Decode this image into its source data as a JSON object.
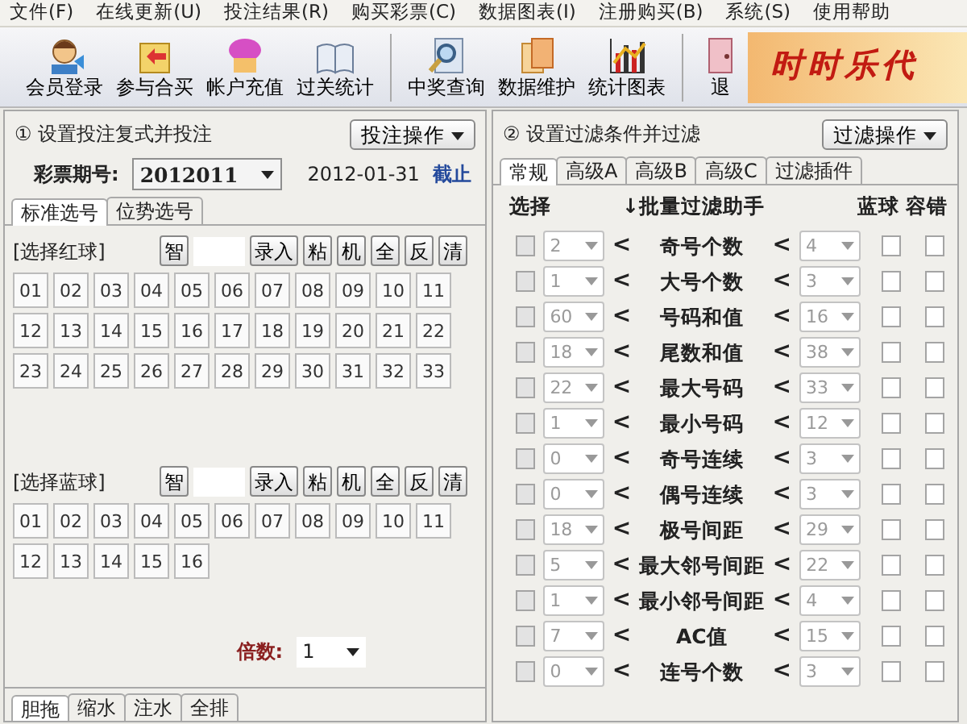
{
  "menu": [
    "文件(F)",
    "在线更新(U)",
    "投注结果(R)",
    "购买彩票(C)",
    "数据图表(I)",
    "注册购买(B)",
    "系统(S)",
    "使用帮助"
  ],
  "toolbar": {
    "groups": [
      [
        "会员登录",
        "参与合买",
        "帐户充值",
        "过关统计"
      ],
      [
        "中奖查询",
        "数据维护",
        "统计图表"
      ],
      [
        "退"
      ]
    ],
    "banner": "时时乐代"
  },
  "bet_panel": {
    "title": "① 设置投注复式并投注",
    "action": "投注操作",
    "issue_label": "彩票期号:",
    "issue": "2012011",
    "date": "2012-01-31",
    "deadline": "截止",
    "tabs": [
      {
        "label": "标准选号",
        "selected": true
      },
      {
        "label": "位势选号",
        "selected": false
      }
    ],
    "red": {
      "label": "[选择红球]",
      "tools": [
        "智",
        "录入",
        "粘",
        "机",
        "全",
        "反",
        "清"
      ],
      "balls": [
        "01",
        "02",
        "03",
        "04",
        "05",
        "06",
        "07",
        "08",
        "09",
        "10",
        "11",
        "12",
        "13",
        "14",
        "15",
        "16",
        "17",
        "18",
        "19",
        "20",
        "21",
        "22",
        "23",
        "24",
        "25",
        "26",
        "27",
        "28",
        "29",
        "30",
        "31",
        "32",
        "33"
      ]
    },
    "blue": {
      "label": "[选择蓝球]",
      "tools": [
        "智",
        "录入",
        "粘",
        "机",
        "全",
        "反",
        "清"
      ],
      "balls": [
        "01",
        "02",
        "03",
        "04",
        "05",
        "06",
        "07",
        "08",
        "09",
        "10",
        "11",
        "12",
        "13",
        "14",
        "15",
        "16"
      ]
    },
    "multiple_label": "倍数:",
    "multiple": "1",
    "bottom_tabs": [
      {
        "label": "胆拖",
        "selected": true
      },
      {
        "label": "缩水",
        "selected": false
      },
      {
        "label": "注水",
        "selected": false
      },
      {
        "label": "全排",
        "selected": false
      }
    ]
  },
  "filter_panel": {
    "title": "② 设置过滤条件并过滤",
    "action": "过滤操作",
    "tabs": [
      {
        "label": "常规",
        "selected": true
      },
      {
        "label": "高级A",
        "selected": false
      },
      {
        "label": "高级B",
        "selected": false
      },
      {
        "label": "高级C",
        "selected": false
      },
      {
        "label": "过滤插件",
        "selected": false
      }
    ],
    "columns": [
      "选择",
      "↓批量过滤助手",
      "蓝球",
      "容错"
    ],
    "lt": "<",
    "rows": [
      {
        "checked": false,
        "min": "2",
        "name": "奇号个数",
        "max": "4",
        "blue": false,
        "tolerance": false,
        "disabled": true
      },
      {
        "checked": false,
        "min": "1",
        "name": "大号个数",
        "max": "3",
        "blue": false,
        "tolerance": false,
        "disabled": true
      },
      {
        "checked": false,
        "min": "60",
        "name": "号码和值",
        "max": "16",
        "blue": false,
        "tolerance": false,
        "disabled": true
      },
      {
        "checked": false,
        "min": "18",
        "name": "尾数和值",
        "max": "38",
        "blue": false,
        "tolerance": false,
        "disabled": true
      },
      {
        "checked": false,
        "min": "22",
        "name": "最大号码",
        "max": "33",
        "blue": false,
        "tolerance": false,
        "disabled": true
      },
      {
        "checked": false,
        "min": "1",
        "name": "最小号码",
        "max": "12",
        "blue": false,
        "tolerance": false,
        "disabled": true
      },
      {
        "checked": false,
        "min": "0",
        "name": "奇号连续",
        "max": "3",
        "blue": false,
        "tolerance": false,
        "disabled": true
      },
      {
        "checked": false,
        "min": "0",
        "name": "偶号连续",
        "max": "3",
        "blue": false,
        "tolerance": false,
        "disabled": true
      },
      {
        "checked": false,
        "min": "18",
        "name": "极号间距",
        "max": "29",
        "blue": false,
        "tolerance": false,
        "disabled": true
      },
      {
        "checked": false,
        "min": "5",
        "name": "最大邻号间距",
        "max": "22",
        "blue": false,
        "tolerance": false,
        "disabled": true
      },
      {
        "checked": false,
        "min": "1",
        "name": "最小邻号间距",
        "max": "4",
        "blue": false,
        "tolerance": false,
        "disabled": true
      },
      {
        "checked": false,
        "min": "7",
        "name": "AC值",
        "max": "15",
        "blue": false,
        "tolerance": false,
        "disabled": true
      },
      {
        "checked": false,
        "min": "0",
        "name": "连号个数",
        "max": "3",
        "blue": false,
        "tolerance": false,
        "disabled": true
      }
    ]
  }
}
